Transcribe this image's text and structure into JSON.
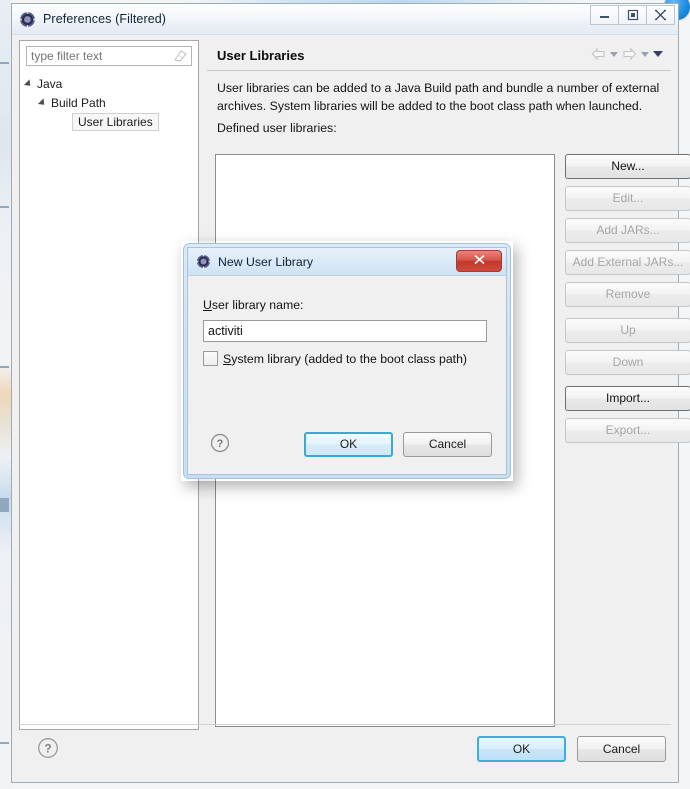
{
  "window": {
    "title": "Preferences (Filtered)",
    "icon": "eclipse-gear-icon",
    "minimize_label": "–",
    "maximize_label": "□",
    "close_label": "✕"
  },
  "sidebar": {
    "filter": {
      "value": "",
      "placeholder": "type filter text",
      "clear_icon": "eraser-icon"
    },
    "tree": [
      {
        "label": "Java",
        "level": 1,
        "expanded": true,
        "selected": false
      },
      {
        "label": "Build Path",
        "level": 2,
        "expanded": true,
        "selected": false
      },
      {
        "label": "User Libraries",
        "level": 3,
        "expanded": false,
        "selected": true
      }
    ]
  },
  "page": {
    "title": "User Libraries",
    "nav": {
      "back_icon": "arrow-left-icon",
      "back_menu_icon": "chevron-down-icon",
      "forward_icon": "arrow-right-icon",
      "forward_menu_icon": "chevron-down-icon",
      "view_menu_icon": "chevron-down-icon"
    },
    "description": "User libraries can be added to a Java Build path and bundle a number of external archives. System libraries will be added to the boot class path when launched.",
    "defined_label": "Defined user libraries:",
    "list_items": [],
    "buttons": [
      {
        "label": "New...",
        "enabled": true
      },
      {
        "label": "Edit...",
        "enabled": false
      },
      {
        "label": "Add JARs...",
        "enabled": false
      },
      {
        "label": "Add External JARs...",
        "enabled": false
      },
      {
        "label": "Remove",
        "enabled": false
      },
      {
        "label": "Up",
        "enabled": false,
        "gap": true
      },
      {
        "label": "Down",
        "enabled": false
      },
      {
        "label": "Import...",
        "enabled": true,
        "gap": true
      },
      {
        "label": "Export...",
        "enabled": false
      }
    ]
  },
  "footer": {
    "help_icon": "help-question-icon",
    "ok_label": "OK",
    "cancel_label": "Cancel"
  },
  "dialog": {
    "title": "New User Library",
    "icon": "eclipse-gear-icon",
    "close_label": "✕",
    "field_label_prefix": "U",
    "field_label_rest": "ser library name:",
    "input_value": "activiti",
    "input_placeholder": "",
    "checkbox": {
      "checked": false,
      "label_prefix": "S",
      "label_rest": "ystem library (added to the boot class path)"
    },
    "help_icon": "help-question-icon",
    "ok_label": "OK",
    "cancel_label": "Cancel"
  },
  "colors": {
    "default_button_border": "#3aa9d6",
    "close_button_red": "#c2382c",
    "title_text": "#10203a",
    "window_bg": "#f0f0f0"
  }
}
